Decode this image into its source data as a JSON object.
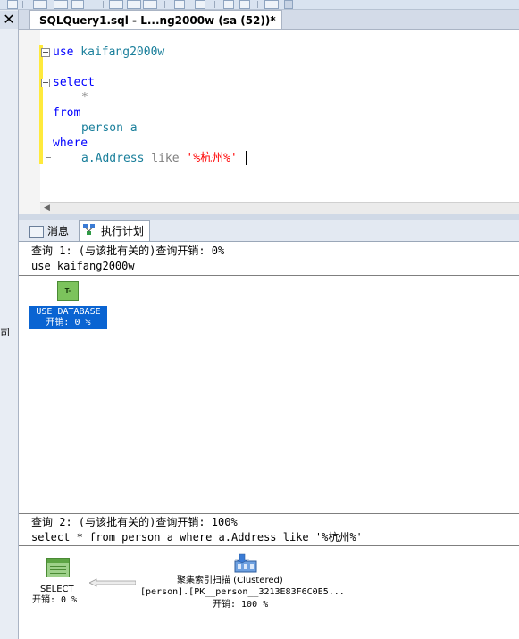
{
  "document_tab": {
    "title": "SQLQuery1.sql - L...ng2000w (sa (52))*"
  },
  "left_pane": {
    "close_glyph": "✕",
    "clipped_text": "司"
  },
  "editor": {
    "line1": {
      "kw": "use",
      "rest": " kaifang2000w"
    },
    "line2": {
      "kw": "select"
    },
    "line3": {
      "text": "*"
    },
    "line4": {
      "kw": "from"
    },
    "line5": {
      "text": "person a"
    },
    "line6": {
      "kw": "where"
    },
    "line7": {
      "col": "a.Address",
      "op": " like ",
      "str": "'%杭州%'"
    }
  },
  "results": {
    "tabs": [
      {
        "label": "消息",
        "icon": "messages-icon"
      },
      {
        "label": "执行计划",
        "icon": "execution-plan-icon",
        "active": true
      }
    ],
    "query1": {
      "header": "查询 1: (与该批有关的)查询开销: 0%",
      "sql": "use kaifang2000w",
      "node_icon_label": "T-SQL",
      "node_line1": "USE DATABASE",
      "node_line2": "开销: 0 %"
    },
    "query2": {
      "header": "查询 2: (与该批有关的)查询开销: 100%",
      "sql": "select * from person a where a.Address like '%杭州%'",
      "select_node": {
        "line1": "SELECT",
        "line2": "开销: 0 %"
      },
      "scan_node": {
        "line1": "聚集索引扫描 (Clustered)",
        "line2": "[person].[PK__person__3213E83F6C0E5...",
        "line3": "开销: 100 %"
      }
    }
  }
}
